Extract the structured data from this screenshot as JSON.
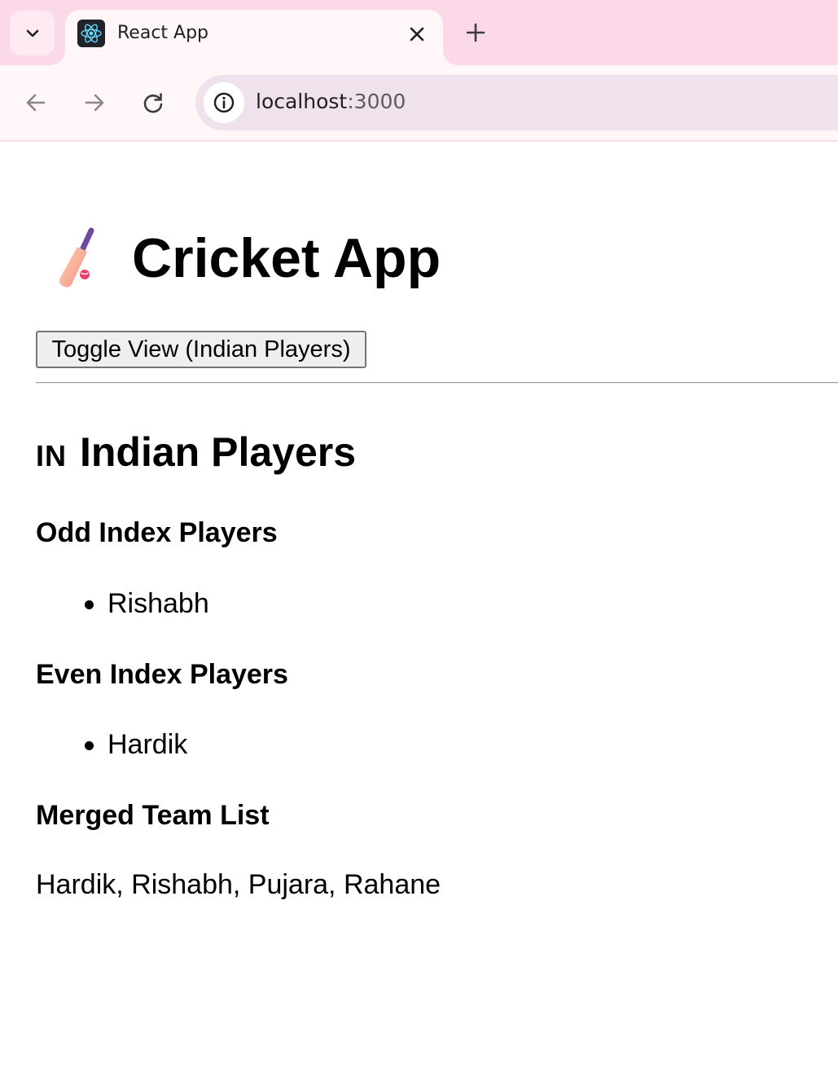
{
  "browser": {
    "tab": {
      "title": "React App",
      "favicon_icon": "react-logo-icon",
      "close_icon": "close-icon"
    },
    "tab_search_icon": "chevron-down-icon",
    "new_tab_icon": "plus-icon",
    "nav": {
      "back_icon": "arrow-left-icon",
      "forward_icon": "arrow-right-icon",
      "reload_icon": "reload-icon"
    },
    "address_bar": {
      "site_info_icon": "info-icon",
      "host": "localhost",
      "port": ":3000"
    },
    "colors": {
      "tabstrip": "#fbd9e9",
      "toolbar": "#fff6f8",
      "omnibox": "#f0e2ec"
    }
  },
  "page": {
    "title": "Cricket App",
    "title_icon": "cricket-bat-icon",
    "toggle_button_label": "Toggle View (Indian Players)",
    "section_flag": "IN",
    "section_title": "Indian Players",
    "odd": {
      "heading": "Odd Index Players",
      "players": [
        "Rishabh"
      ]
    },
    "even": {
      "heading": "Even Index Players",
      "players": [
        "Hardik"
      ]
    },
    "merged": {
      "heading": "Merged Team List",
      "text": "Hardik, Rishabh, Pujara, Rahane"
    }
  }
}
